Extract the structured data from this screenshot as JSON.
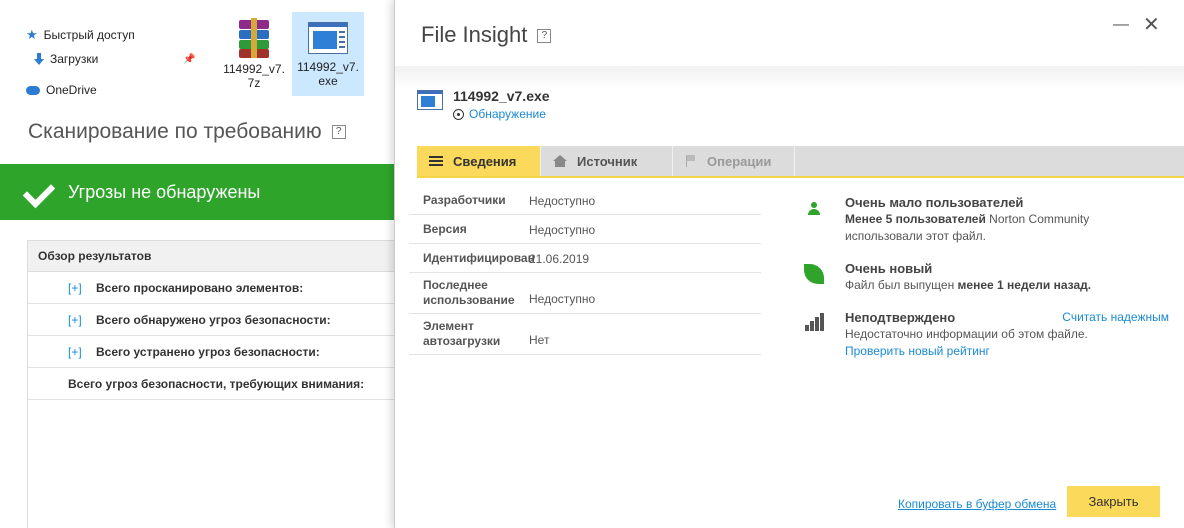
{
  "explorer": {
    "nav": [
      {
        "label": "Быстрый доступ",
        "icon": "star-icon"
      },
      {
        "label": "Загрузки",
        "icon": "download-icon"
      },
      {
        "label": "OneDrive",
        "icon": "cloud-icon"
      }
    ],
    "files": [
      {
        "line1": "114992_v7.",
        "line2": "7z",
        "icon": "winrar-archive-icon"
      },
      {
        "line1": "114992_v7.",
        "line2": "exe",
        "icon": "exe-file-icon"
      }
    ]
  },
  "scan": {
    "title": "Сканирование по требованию",
    "help": "?",
    "banner": "Угрозы не обнаружены",
    "banner_color": "#2ea52a",
    "results_header": "Обзор результатов",
    "rows": [
      {
        "expander": "[+]",
        "label": "Всего просканировано элементов:"
      },
      {
        "expander": "[+]",
        "label": "Всего обнаружено угроз безопасности:"
      },
      {
        "expander": "[+]",
        "label": "Всего устранено угроз безопасности:"
      },
      {
        "expander": "",
        "label": "Всего угроз безопасности, требующих внимания:"
      }
    ]
  },
  "insight": {
    "title": "File Insight",
    "help": "?",
    "minimize": "—",
    "close": "✕",
    "file_name": "114992_v7.exe",
    "detection_link": "Обнаружение",
    "tabs": [
      {
        "label": "Сведения",
        "icon": "list-icon"
      },
      {
        "label": "Источник",
        "icon": "home-icon"
      },
      {
        "label": "Операции",
        "icon": "flag-icon"
      }
    ],
    "details": [
      {
        "label": "Разработчики",
        "value": "Недоступно"
      },
      {
        "label": "Версия",
        "value": "Недоступно"
      },
      {
        "label": "Идентифицирован",
        "value": "21.06.2019"
      },
      {
        "label": "Последнее использование",
        "value": "Недоступно"
      },
      {
        "label": "Элемент автозагрузки",
        "value": "Нет"
      }
    ],
    "users": {
      "title": "Очень мало пользователей",
      "bold": "Менее 5 пользователей",
      "rest": " Norton Community",
      "line2": "использовали этот файл."
    },
    "newness": {
      "title": "Очень новый",
      "pre": "Файл был выпущен ",
      "bold": "менее 1 недели назад."
    },
    "unverified": {
      "title": "Неподтверждено",
      "trust_link": "Считать надежным",
      "text": "Недостаточно информации об этом файле.",
      "check_link": "Проверить новый рейтинг"
    },
    "copy_link": "Копировать в буфер обмена",
    "close_button": "Закрыть",
    "accent_color": "#fbd95a"
  }
}
